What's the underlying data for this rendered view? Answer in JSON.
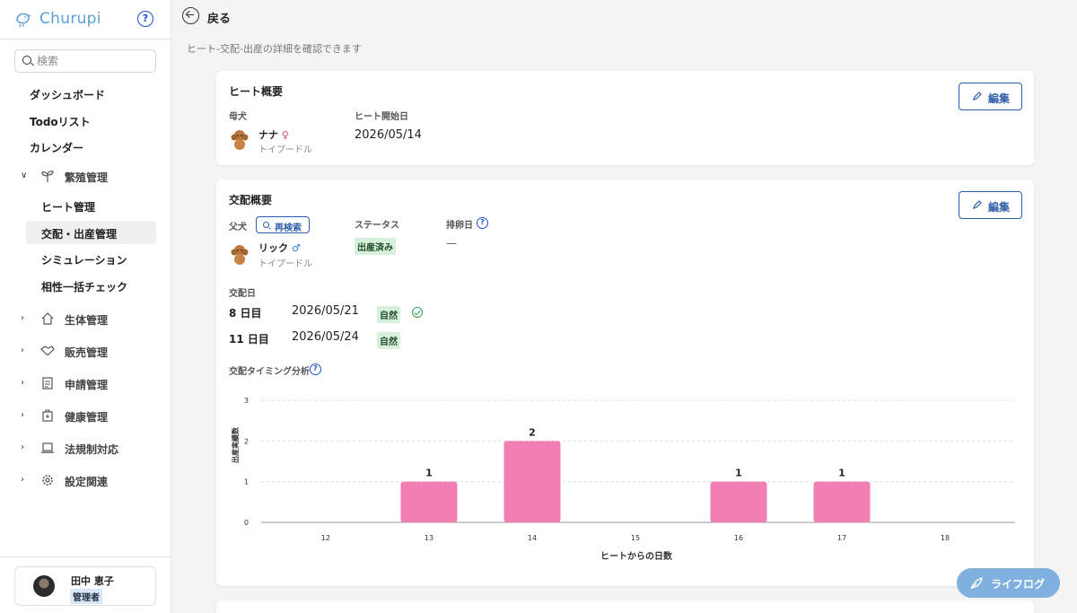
{
  "app": {
    "name": "Churupi"
  },
  "sidebar": {
    "search_placeholder": "検索",
    "top_items": [
      "ダッシュボード",
      "Todoリスト",
      "カレンダー"
    ],
    "breeding_group": {
      "label": "繁殖管理",
      "items": [
        "ヒート管理",
        "交配・出産管理",
        "シミュレーション",
        "相性一括チェック"
      ],
      "active_index": 1
    },
    "groups": [
      {
        "label": "生体管理",
        "icon": "house-icon"
      },
      {
        "label": "販売管理",
        "icon": "handshake-icon"
      },
      {
        "label": "申請管理",
        "icon": "document-icon"
      },
      {
        "label": "健康管理",
        "icon": "medical-kit-icon"
      },
      {
        "label": "法規制対応",
        "icon": "laptop-icon"
      },
      {
        "label": "設定関連",
        "icon": "gear-icon"
      }
    ],
    "user": {
      "name": "田中 恵子",
      "role": "管理者"
    }
  },
  "header": {
    "back_label": "戻る",
    "subtitle": "ヒート-交配-出産の詳細を確認できます"
  },
  "heat_card": {
    "title": "ヒート概要",
    "edit_label": "編集",
    "mother_label": "母犬",
    "mother_name": "ナナ",
    "mother_sex": "♀",
    "mother_breed": "トイプードル",
    "start_label": "ヒート開始日",
    "start_date": "2026/05/14"
  },
  "mating_card": {
    "title": "交配概要",
    "edit_label": "編集",
    "father_label": "父犬",
    "research_label": "再検索",
    "father_name": "リック",
    "father_sex": "♂",
    "father_breed": "トイプードル",
    "status_label": "ステータス",
    "status_value": "出産済み",
    "ovulation_label": "排卵日",
    "ovulation_value": "—",
    "mating_date_label": "交配日",
    "matings": [
      {
        "day": "8 日目",
        "date": "2026/05/21",
        "type": "自然",
        "confirmed": true
      },
      {
        "day": "11 日目",
        "date": "2026/05/24",
        "type": "自然",
        "confirmed": false
      }
    ],
    "analysis_label": "交配タイミング分析"
  },
  "chart_data": {
    "type": "bar",
    "categories": [
      "12",
      "13",
      "14",
      "15",
      "16",
      "17",
      "18"
    ],
    "values": [
      0,
      1,
      2,
      0,
      1,
      1,
      0
    ],
    "xlabel": "ヒートからの日数",
    "ylabel": "出産実績数",
    "ylim": [
      0,
      3
    ],
    "yticks": [
      "0",
      "1",
      "2",
      "3"
    ],
    "grid": true,
    "bar_color": "#f17fb3"
  },
  "colors": {
    "accent": "#2f5ea8",
    "bar": "#f17fb3",
    "badge_green": "#d6f0dc",
    "lifelog": "#7fb0de"
  },
  "lifelog_label": "ライフログ"
}
